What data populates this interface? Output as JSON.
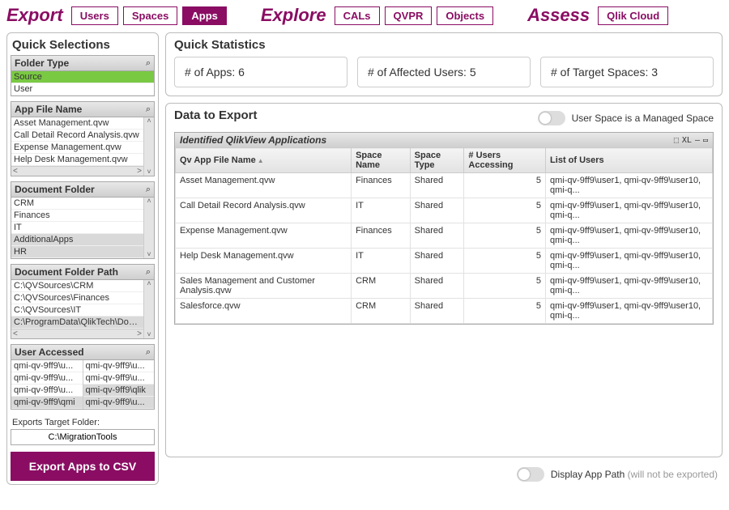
{
  "header": {
    "export": {
      "label": "Export",
      "tabs": [
        "Users",
        "Spaces",
        "Apps"
      ],
      "active": 2
    },
    "explore": {
      "label": "Explore",
      "tabs": [
        "CALs",
        "QVPR",
        "Objects"
      ],
      "active": -1
    },
    "assess": {
      "label": "Assess",
      "tabs": [
        "Qlik Cloud"
      ],
      "active": -1
    }
  },
  "sidebar": {
    "title": "Quick Selections",
    "folderType": {
      "title": "Folder Type",
      "items": [
        "Source",
        "User"
      ],
      "selected": 0
    },
    "appFileName": {
      "title": "App File Name",
      "items": [
        "Asset Management.qvw",
        "Call Detail Record Analysis.qvw",
        "Expense Management.qvw",
        "Help Desk Management.qvw"
      ]
    },
    "documentFolder": {
      "title": "Document Folder",
      "items": [
        "CRM",
        "Finances",
        "IT",
        "AdditionalApps",
        "HR"
      ],
      "greyFrom": 3
    },
    "documentFolderPath": {
      "title": "Document Folder Path",
      "items": [
        "C:\\QVSources\\CRM",
        "C:\\QVSources\\Finances",
        "C:\\QVSources\\IT",
        "C:\\ProgramData\\QlikTech\\Docum..."
      ],
      "greyFrom": 3
    },
    "userAccessed": {
      "title": "User Accessed",
      "col1": [
        "qmi-qv-9ff9\\u...",
        "qmi-qv-9ff9\\u...",
        "qmi-qv-9ff9\\u...",
        "qmi-qv-9ff9\\qmi"
      ],
      "col2": [
        "qmi-qv-9ff9\\u...",
        "qmi-qv-9ff9\\u...",
        "qmi-qv-9ff9\\qlik",
        "qmi-qv-9ff9\\u..."
      ],
      "greyRow": 3,
      "greyCol2Row": 2
    },
    "targetFolderLabel": "Exports Target Folder:",
    "targetFolderValue": "C:\\MigrationTools",
    "exportButton": "Export Apps to CSV"
  },
  "stats": {
    "title": "Quick Statistics",
    "items": [
      {
        "label": "# of Apps:",
        "value": "6"
      },
      {
        "label": "# of Affected Users:",
        "value": "5"
      },
      {
        "label": "# of Target Spaces:",
        "value": "3"
      }
    ]
  },
  "dataPanel": {
    "title": "Data to Export",
    "toggleLabel": "User Space is a Managed Space",
    "tableTitle": "Identified QlikView Applications",
    "tableIcons": [
      "�床",
      "XL",
      "⬜",
      "❐"
    ],
    "columns": [
      "Qv App File Name",
      "Space Name",
      "Space Type",
      "# Users Accessing",
      "List of Users"
    ],
    "rows": [
      {
        "name": "Asset Management.qvw",
        "space": "Finances",
        "type": "Shared",
        "users": "5",
        "list": "qmi-qv-9ff9\\user1, qmi-qv-9ff9\\user10, qmi-q..."
      },
      {
        "name": "Call Detail Record Analysis.qvw",
        "space": "IT",
        "type": "Shared",
        "users": "5",
        "list": "qmi-qv-9ff9\\user1, qmi-qv-9ff9\\user10, qmi-q..."
      },
      {
        "name": "Expense Management.qvw",
        "space": "Finances",
        "type": "Shared",
        "users": "5",
        "list": "qmi-qv-9ff9\\user1, qmi-qv-9ff9\\user10, qmi-q..."
      },
      {
        "name": "Help Desk Management.qvw",
        "space": "IT",
        "type": "Shared",
        "users": "5",
        "list": "qmi-qv-9ff9\\user1, qmi-qv-9ff9\\user10, qmi-q..."
      },
      {
        "name": "Sales Management and Customer Analysis.qvw",
        "space": "CRM",
        "type": "Shared",
        "users": "5",
        "list": "qmi-qv-9ff9\\user1, qmi-qv-9ff9\\user10, qmi-q..."
      },
      {
        "name": "Salesforce.qvw",
        "space": "CRM",
        "type": "Shared",
        "users": "5",
        "list": "qmi-qv-9ff9\\user1, qmi-qv-9ff9\\user10, qmi-q..."
      }
    ]
  },
  "bottomToggle": {
    "label": "Display App Path",
    "hint": "(will not be exported)"
  }
}
